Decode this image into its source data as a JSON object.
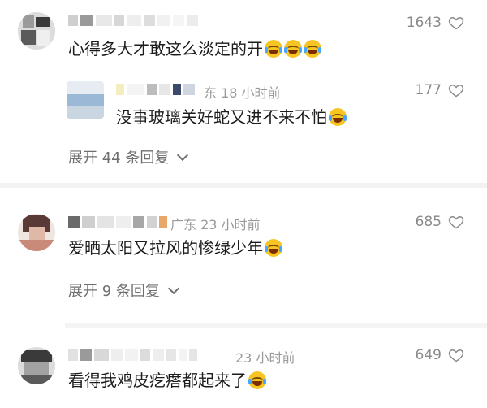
{
  "comments": [
    {
      "meta": "",
      "text": "心得多大才敢这么淡定的开",
      "likes": "1643",
      "replies_label": "",
      "reply": {
        "meta": "东 18 小时前",
        "text": "没事玻璃关好蛇又进不来不怕",
        "likes": "177"
      },
      "expand": "展开 44 条回复"
    },
    {
      "meta": "广东 23 小时前",
      "text": "爱晒太阳又拉风的惨绿少年",
      "likes": "685",
      "expand": "展开 9 条回复"
    },
    {
      "meta": "23 小时前",
      "text": "看得我鸡皮疙瘩都起来了",
      "likes": "649"
    }
  ],
  "icons": {
    "like": "heart-outline-icon",
    "expand": "chevron-down-icon",
    "emoji": "laughing-tears-emoji"
  },
  "colors": {
    "text": "#1c1c1c",
    "meta": "#9a9a9a",
    "expand": "#6f6f6f",
    "emoji": "#f7c523"
  }
}
